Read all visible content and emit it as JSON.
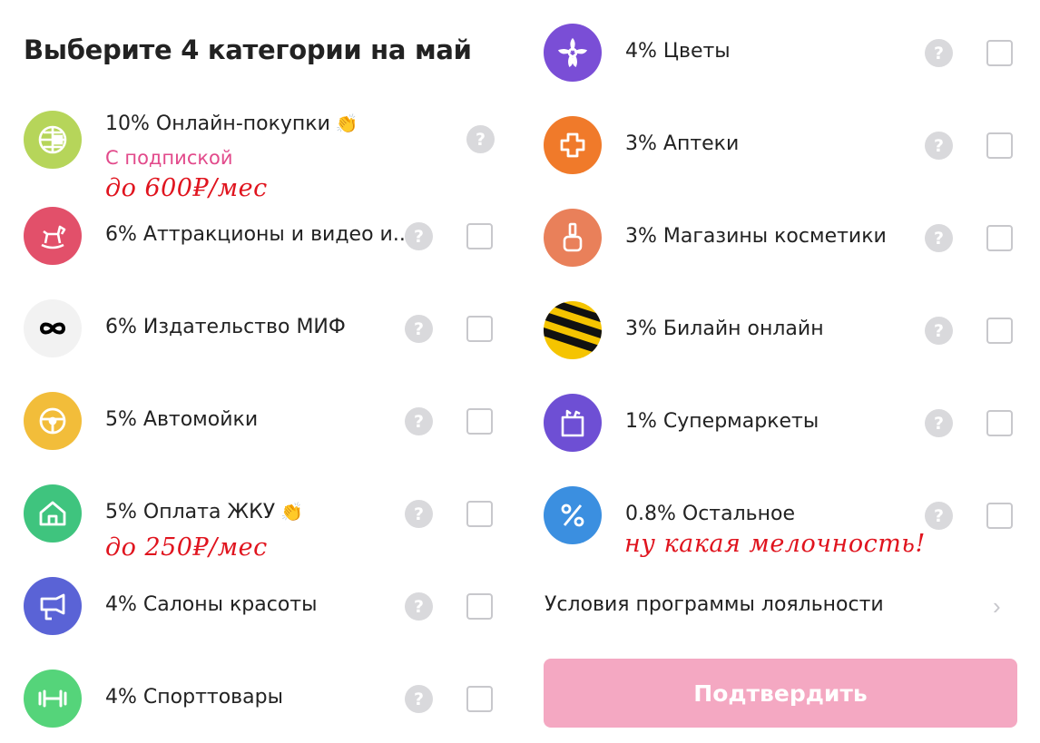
{
  "title": "Выберите 4 категории на май",
  "left": [
    {
      "label": "10% Онлайн-покупки",
      "sub": "С подпиской",
      "note": "до 600₽/мес",
      "icon": "globe-card-icon",
      "color": "#b6d55a"
    },
    {
      "label": "6% Аттракционы и видео и...",
      "icon": "rocking-horse-icon",
      "color": "#e2506a"
    },
    {
      "label": "6% Издательство МИФ",
      "icon": "infinity-icon",
      "color": "#f2f2f2"
    },
    {
      "label": "5% Автомойки",
      "icon": "steering-wheel-icon",
      "color": "#f2bd3a"
    },
    {
      "label": "5% Оплата ЖКУ",
      "note": "до 250₽/мес",
      "icon": "house-icon",
      "color": "#3fc47e"
    },
    {
      "label": "4% Салоны красоты",
      "icon": "hair-dryer-icon",
      "color": "#5a63d6"
    },
    {
      "label": "4% Спорттовары",
      "icon": "dumbbell-icon",
      "color": "#55d47a"
    }
  ],
  "right": [
    {
      "label": "4% Цветы",
      "icon": "flower-icon",
      "color": "#7a4ed6"
    },
    {
      "label": "3% Аптеки",
      "icon": "pharmacy-cross-icon",
      "color": "#f07a2a"
    },
    {
      "label": "3% Магазины косметики",
      "icon": "nail-polish-icon",
      "color": "#e9805a"
    },
    {
      "label": "3% Билайн онлайн",
      "icon": "beeline-icon",
      "color": "#f5c400"
    },
    {
      "label": "1% Супермаркеты",
      "icon": "grocery-bag-icon",
      "color": "#6e4fd4"
    },
    {
      "label": "0.8% Остальное",
      "note": "ну какая мелочность!",
      "icon": "percent-icon",
      "color": "#3b8fe0"
    }
  ],
  "help_glyph": "?",
  "loyalty_link": "Условия программы лояльности",
  "chevron": "›",
  "confirm_label": "Подтвердить",
  "clap": "👏"
}
